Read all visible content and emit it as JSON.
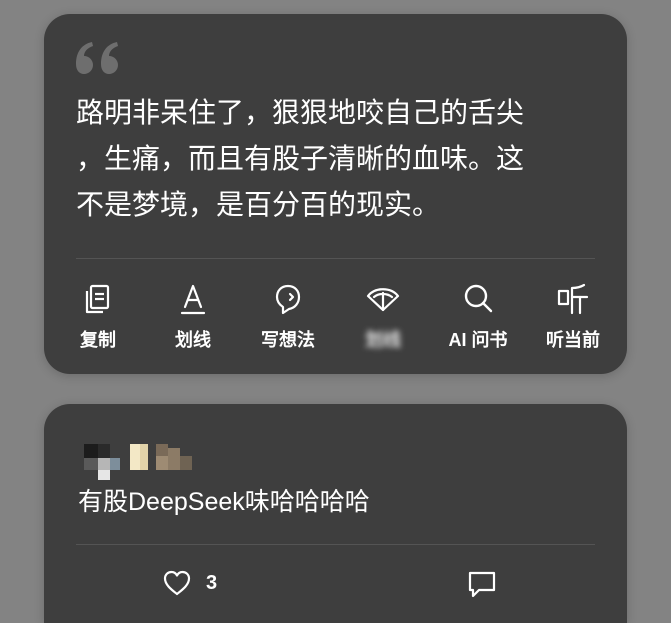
{
  "quote": {
    "text": "路明非呆住了，狠狠地咬自己的舌尖，生痛，而且有股子清晰的血味。这不是梦境，是百分百的现实。",
    "lines": [
      "路明非呆住了，狠狠地咬自己的舌尖",
      "，生痛，而且有股子清晰的血味。这",
      "不是梦境，是百分百的现实。"
    ]
  },
  "actions": [
    {
      "label": "复制",
      "icon": "copy-icon"
    },
    {
      "label": "划线",
      "icon": "underline-icon"
    },
    {
      "label": "写想法",
      "icon": "thought-bubble-icon"
    },
    {
      "label": "划线",
      "icon": "share-fan-icon",
      "obscured": true
    },
    {
      "label": "AI 问书",
      "icon": "search-icon"
    },
    {
      "label": "听当前",
      "icon": "listen-icon"
    }
  ],
  "comment": {
    "username_obscured": true,
    "text": "有股DeepSeek味哈哈哈哈",
    "like_count": "3"
  },
  "colors": {
    "background": "#838383",
    "card": "#3e3e3e",
    "text": "#ffffff",
    "divider": "#545454"
  }
}
